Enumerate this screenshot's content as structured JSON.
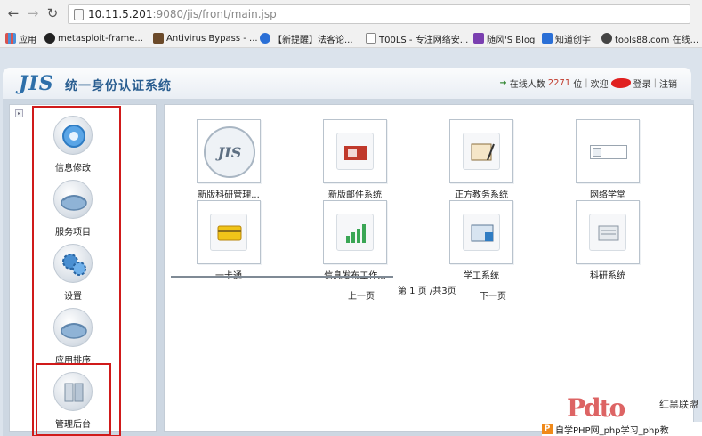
{
  "browser": {
    "url_host": "10.11.5.201",
    "url_rest": ":9080/jis/front/main.jsp",
    "bookmarks": [
      {
        "label": "应用",
        "icon": "apps-grid-icon",
        "color": "#d9534f"
      },
      {
        "label": "metasploit-frame...",
        "icon": "github-icon",
        "color": "#222222"
      },
      {
        "label": "Antivirus Bypass - ...",
        "icon": "bookmark-page-icon",
        "color": "#6b4a2a"
      },
      {
        "label": "【新提醒】法客论...",
        "icon": "forum-icon",
        "color": "#2a6fd6"
      },
      {
        "label": "T00LS - 专注网络安...",
        "icon": "tools-page-icon",
        "color": "#888888"
      },
      {
        "label": "随风'S Blog",
        "icon": "blog-icon",
        "color": "#7a3fb0"
      },
      {
        "label": "知道创宇",
        "icon": "knownsec-icon",
        "color": "#2a6fd6"
      },
      {
        "label": "tools88.com 在线...",
        "icon": "radiation-icon",
        "color": "#444444"
      }
    ]
  },
  "header": {
    "logo": "JIS",
    "title": "统一身份认证系统",
    "online_prefix": "在线人数",
    "online_count": "2271",
    "online_suffix": "位",
    "welcome": "欢迎",
    "login": "登录",
    "logout": "注销"
  },
  "sidebar": {
    "items": [
      {
        "label": "信息修改",
        "icon": "info-edit-icon"
      },
      {
        "label": "服务项目",
        "icon": "service-items-icon"
      },
      {
        "label": "设置",
        "icon": "settings-gears-icon"
      },
      {
        "label": "应用排序",
        "icon": "app-sort-icon"
      },
      {
        "label": "管理后台",
        "icon": "admin-backend-icon"
      }
    ]
  },
  "apps": [
    {
      "label": "新版科研管理...",
      "icon": "jis-logo-icon"
    },
    {
      "label": "新版邮件系统",
      "icon": "mailbox-icon"
    },
    {
      "label": "正方教务系统",
      "icon": "notebook-pen-icon"
    },
    {
      "label": "网络学堂",
      "icon": "broken-image-icon"
    },
    {
      "label": "一卡通",
      "icon": "card-icon"
    },
    {
      "label": "信息发布工作...",
      "icon": "bar-chart-icon"
    },
    {
      "label": "学工系统",
      "icon": "book-icon"
    },
    {
      "label": "科研系统",
      "icon": "research-icon"
    }
  ],
  "pager": {
    "prev": "上一页",
    "page_info": "第 1 页 /共3页",
    "next": "下一页"
  },
  "watermark": {
    "logo": "Pdto",
    "brand": "红黑联盟",
    "caption": "自学PHP网_php学习_php教"
  }
}
